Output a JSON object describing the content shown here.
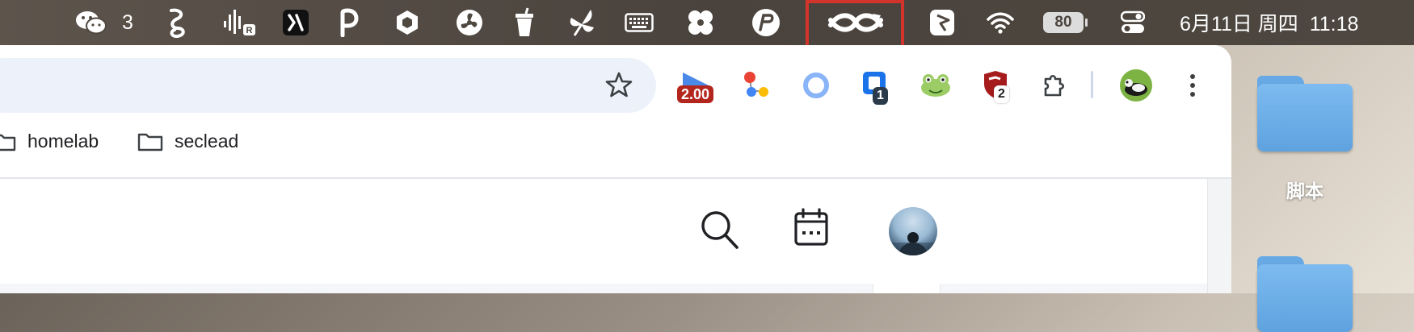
{
  "menubar": {
    "wechat_count": "3",
    "date_time": "6月11日 周四  11:18",
    "battery_percent": "80",
    "icons": [
      "wechat-icon",
      "dragon-icon",
      "audio-levels-icon",
      "xcode-dark-icon",
      "p-icon",
      "hex-icon",
      "fan-icon",
      "cup-icon",
      "butterfly-icon",
      "keyboard-icon",
      "clover-icon",
      "pp-icon",
      "sync-wave-icon",
      "arrow-shield-icon",
      "wifi-icon",
      "battery-icon",
      "control-center-icon"
    ]
  },
  "browser": {
    "extensions": {
      "rate_badge": "2.00",
      "notify_badge": "1",
      "shield_badge": "2"
    },
    "bookmarks": [
      {
        "label": "homelab"
      },
      {
        "label": "seclead"
      }
    ]
  },
  "desktop": {
    "folder_label": "脚本"
  },
  "colors": {
    "highlight": "#d2332b",
    "omnibox_bg": "#edf2fa",
    "folder": "#6fb0ea"
  }
}
